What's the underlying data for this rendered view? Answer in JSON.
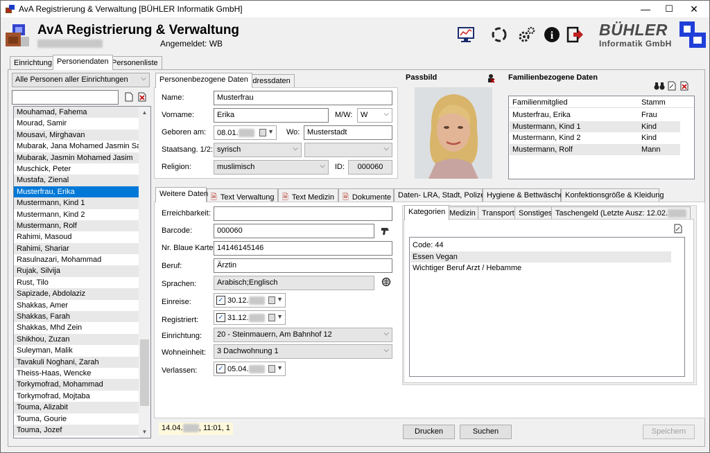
{
  "window": {
    "title": "AvA Registrierung & Verwaltung [BÜHLER Informatik GmbH]",
    "minimize": "—",
    "maximize": "☐",
    "close": "✕"
  },
  "header": {
    "app_title": "AvA Registrierung & Verwaltung",
    "subtitle": "████████████",
    "login_label": "Angemeldet: WB",
    "brand_line1": "BÜHLER",
    "brand_line2": "Informatik GmbH"
  },
  "main_tabs": [
    "Einrichtung",
    "Personendaten",
    "Personenliste"
  ],
  "filter": {
    "selected": "Alle Personen aller Einrichtungen",
    "search_value": ""
  },
  "persons": [
    "Mouhamad, Fahema",
    "Mourad, Samir",
    "Mousavi, Mirghavan",
    "Mubarak, Jana Mohamed Jasmin Sa...",
    "Mubarak, Jasmin Mohamed Jasim",
    "Muschick, Peter",
    "Mustafa, Zienal",
    "Musterfrau, Erika",
    "Mustermann, Kind 1",
    "Mustermann, Kind 2",
    "Mustermann, Rolf",
    "Rahimi, Masoud",
    "Rahimi, Shariar",
    "Rasulnazari, Mohammad",
    "Rujak, Silvija",
    "Rust, Tilo",
    "Sapizade, Abdolaziz",
    "Shakkas, Amer",
    "Shakkas, Farah",
    "Shakkas, Mhd Zein",
    "Shikhou, Zuzan",
    "Suleyman, Malik",
    "Tavakuli Noghani, Zarah",
    "Theiss-Haas, Wencke",
    "Torkymofrad, Mohammad",
    "Torkymofrad, Mojtaba",
    "Touma, Alizabit",
    "Touma, Gourie",
    "Touma, Jozef"
  ],
  "selected_person_index": 7,
  "person_tabs": [
    "Personenbezogene Daten",
    "Adressdaten"
  ],
  "person": {
    "name_label": "Name:",
    "name": "Musterfrau",
    "vorname_label": "Vorname:",
    "vorname": "Erika",
    "mw_label": "M/W:",
    "mw": "W",
    "geboren_label": "Geboren am:",
    "geboren": "08.01.",
    "wo_label": "Wo:",
    "wo": "Musterstadt",
    "staatsang_label": "Staatsang. 1/2:",
    "staatsang1": "syrisch",
    "staatsang2": "",
    "religion_label": "Religion:",
    "religion": "muslimisch",
    "id_label": "ID:",
    "id": "000060"
  },
  "passbild": {
    "title": "Passbild"
  },
  "familie": {
    "title": "Familienbezogene Daten",
    "col1": "Familienmitglied",
    "col2": "Stamm",
    "rows": [
      {
        "name": "Musterfrau, Erika",
        "stamm": "Frau"
      },
      {
        "name": "Mustermann, Kind 1",
        "stamm": "Kind"
      },
      {
        "name": "Mustermann, Kind 2",
        "stamm": "Kind"
      },
      {
        "name": "Mustermann, Rolf",
        "stamm": "Mann"
      }
    ]
  },
  "detail_tabs": [
    "Weitere Daten",
    "Text Verwaltung",
    "Text Medizin",
    "Dokumente",
    "Daten- LRA, Stadt, Polizei",
    "Hygiene & Bettwäsche",
    "Konfektionsgröße & Kleidung"
  ],
  "weitere": {
    "erreichbarkeit_label": "Erreichbarkeit:",
    "erreichbarkeit": "",
    "barcode_label": "Barcode:",
    "barcode": "000060",
    "blaue_label": "Nr. Blaue Karte:",
    "blaue": "14146145146",
    "beruf_label": "Beruf:",
    "beruf": "Ärztin",
    "sprachen_label": "Sprachen:",
    "sprachen": "Arabisch;Englisch",
    "einreise_label": "Einreise:",
    "einreise": "30.12.",
    "registriert_label": "Registriert:",
    "registriert": "31.12.",
    "einrichtung_label": "Einrichtung:",
    "einrichtung": "20 - Steinmauern, Am Bahnhof 12",
    "wohneinheit_label": "Wohneinheit:",
    "wohneinheit": "3 Dachwohnung 1",
    "verlassen_label": "Verlassen:",
    "verlassen": "05.04."
  },
  "kat_tabs": [
    "Kategorien",
    "Medizin",
    "Transport",
    "Sonstiges",
    "Taschengeld (Letzte Ausz: 12.02."
  ],
  "kategorien": [
    "Code: 44",
    "Essen Vegan",
    "Wichtiger Beruf Arzt / Hebamme"
  ],
  "status": {
    "text_a": "14.04.",
    "text_b": ", 11:01, 1"
  },
  "buttons": {
    "drucken": "Drucken",
    "suchen": "Suchen",
    "speichern": "Speichern"
  },
  "colors": {
    "selection": "#0078d7",
    "alt_row": "#e8e8e8",
    "status_bg": "#fff8dc"
  }
}
